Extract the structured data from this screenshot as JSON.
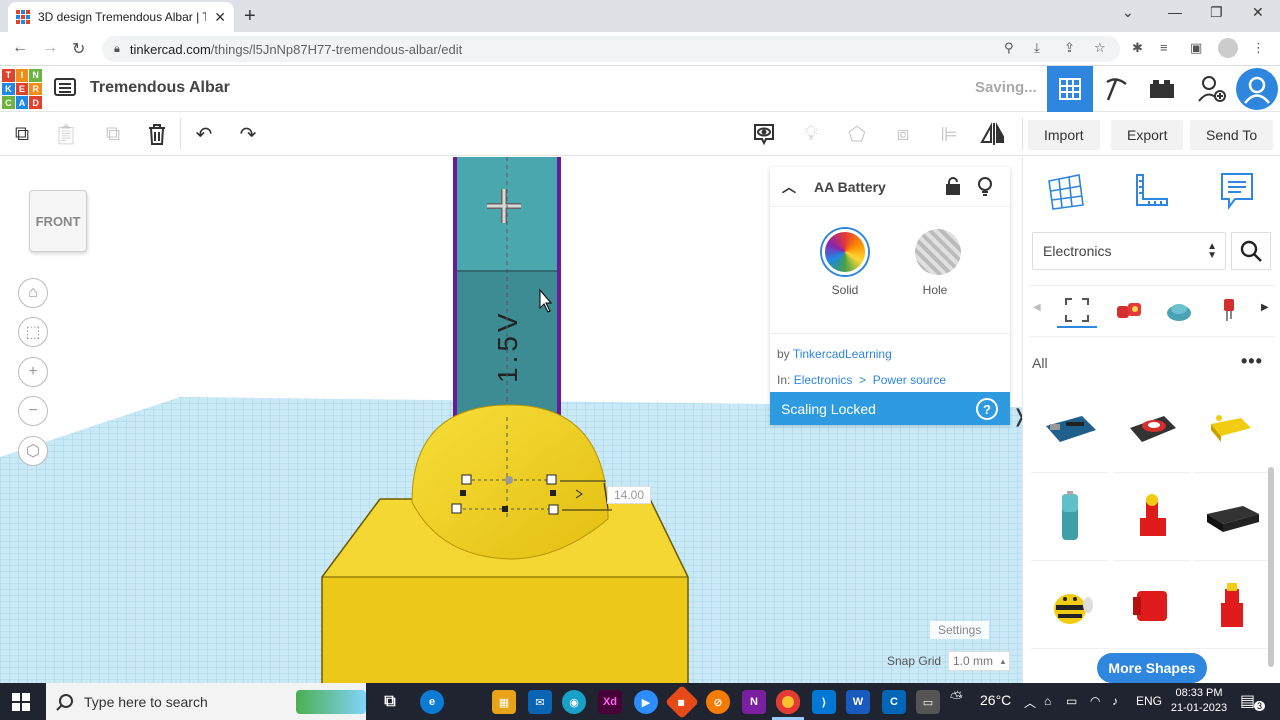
{
  "browser": {
    "tab_title": "3D design Tremendous Albar | Te",
    "url_host": "tinkercad.com",
    "url_path": "/things/l5JnNp87H77-tremendous-albar/edit"
  },
  "app": {
    "logo_letters": [
      "T",
      "I",
      "N",
      "K",
      "E",
      "R",
      "C",
      "A",
      "D"
    ],
    "design_title": "Tremendous Albar",
    "status": "Saving..."
  },
  "toolbar": {
    "import_label": "Import",
    "export_label": "Export",
    "send_label": "Send To"
  },
  "viewport": {
    "viewcube_label": "FRONT",
    "dimension_value": "14.00",
    "battery_text": "1.5V",
    "settings_label": "Settings",
    "snap_label": "Snap Grid",
    "snap_value": "1.0 mm"
  },
  "inspector": {
    "shape_name": "AA Battery",
    "solid_label": "Solid",
    "hole_label": "Hole",
    "by_prefix": "by",
    "author": "TinkercadLearning",
    "in_prefix": "In:",
    "category": "Electronics",
    "sep": ">",
    "subcategory": "Power source",
    "locked_label": "Scaling Locked",
    "help": "?"
  },
  "library": {
    "category_select": "Electronics",
    "all_label": "All",
    "more_label": "More Shapes",
    "shapes": [
      "arduino-board",
      "motor-driver",
      "gear-motor",
      "aa-battery",
      "lever-switch",
      "battery-pack",
      "bee-figure",
      "red-block",
      "red-connector"
    ]
  },
  "taskbar": {
    "search_placeholder": "Type here to search",
    "temperature": "26°C",
    "language": "ENG",
    "time": "08:33 PM",
    "date": "21-01-2023",
    "notifications": "3"
  },
  "colors": {
    "accent": "#2e86de",
    "workplane": "#bfe3f2",
    "shape_yellow": "#f3d31c",
    "battery_teal": "#3f9ea6"
  }
}
